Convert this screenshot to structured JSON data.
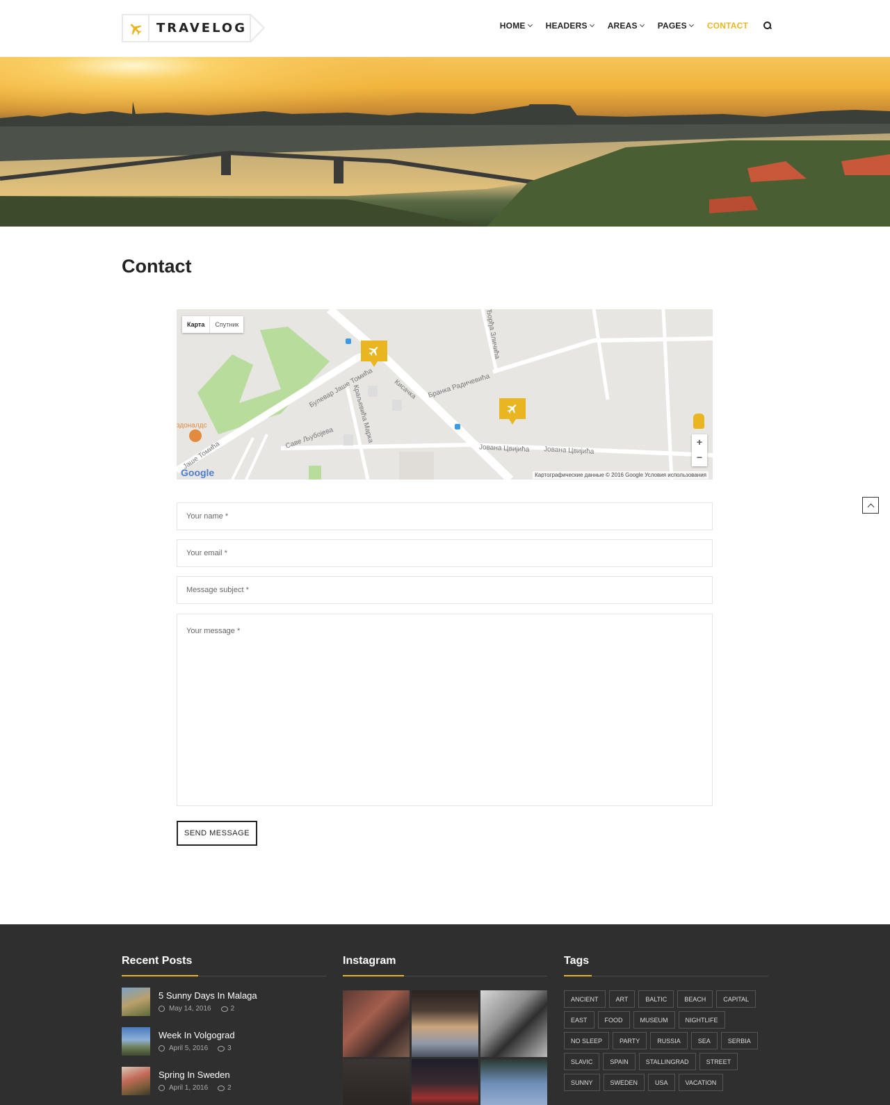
{
  "header": {
    "logo_text": "TRAVELOG",
    "nav": [
      {
        "label": "HOME",
        "dropdown": true
      },
      {
        "label": "HEADERS",
        "dropdown": true
      },
      {
        "label": "AREAS",
        "dropdown": true
      },
      {
        "label": "PAGES",
        "dropdown": true
      },
      {
        "label": "CONTACT",
        "dropdown": false,
        "active": true
      }
    ],
    "accent_color": "#e9b622"
  },
  "page": {
    "title": "Contact"
  },
  "map": {
    "tabs": [
      "Карта",
      "Спутник"
    ],
    "labels": [
      "Булевар Јаше Томића",
      "Краљевића Марка",
      "Кисачка",
      "Бранка Радичевића",
      "Саве Љубојева",
      "Јована Цвијића",
      "Јована Цвијића",
      "Јаше Томића",
      "здоналдс",
      "Ђорђа Зличића"
    ],
    "logo": "Google",
    "copyright": "Картографические данные © 2016 Google    Условия использования",
    "zoom_in": "+",
    "zoom_out": "−"
  },
  "form": {
    "name_placeholder": "Your name *",
    "email_placeholder": "Your email *",
    "subject_placeholder": "Message subject *",
    "message_placeholder": "Your message *",
    "send_label": "SEND MESSAGE"
  },
  "footer": {
    "recent_posts": {
      "title": "Recent Posts",
      "items": [
        {
          "title": "5 Sunny Days In Malaga",
          "date": "May 14, 2016",
          "comments": "2"
        },
        {
          "title": "Week In Volgograd",
          "date": "April 5, 2016",
          "comments": "3"
        },
        {
          "title": "Spring In Sweden",
          "date": "April 1, 2016",
          "comments": "2"
        }
      ]
    },
    "instagram": {
      "title": "Instagram"
    },
    "tags": {
      "title": "Tags",
      "items": [
        "ANCIENT",
        "ART",
        "BALTIC",
        "BEACH",
        "CAPITAL",
        "EAST",
        "FOOD",
        "MUSEUM",
        "NIGHTLIFE",
        "NO SLEEP",
        "PARTY",
        "RUSSIA",
        "SEA",
        "SERBIA",
        "SLAVIC",
        "SPAIN",
        "STALLINGRAD",
        "STREET",
        "SUNNY",
        "SWEDEN",
        "USA",
        "VACATION"
      ]
    }
  }
}
